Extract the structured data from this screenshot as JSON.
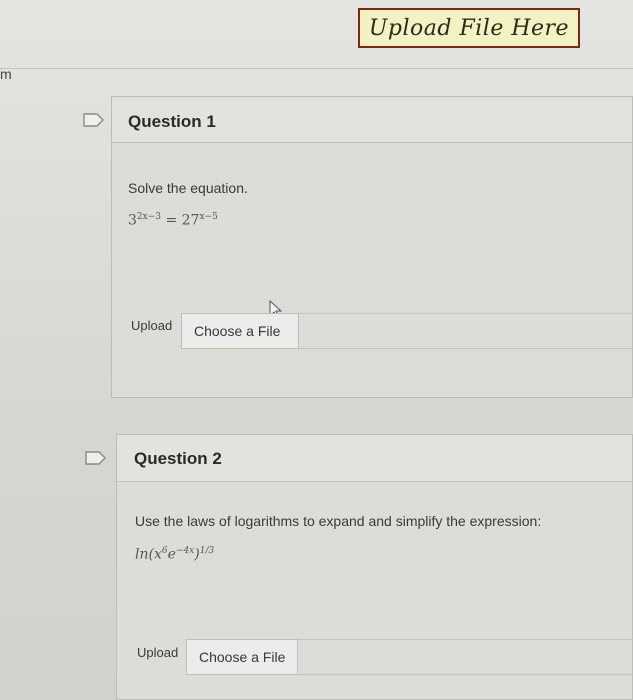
{
  "banner": {
    "label": "Upload File Here"
  },
  "questions": [
    {
      "title": "Question 1",
      "prompt": "Solve the equation.",
      "equation": {
        "base_left": "3",
        "exp_left": "2x−3",
        "equals": "=",
        "base_right": "27",
        "exp_right": "x−5"
      },
      "upload_label": "Upload",
      "file_button": "Choose a File"
    },
    {
      "title": "Question 2",
      "prompt": "Use the laws of logarithms to expand and simplify the expression:",
      "expression": {
        "fn": "ln",
        "inner": "x",
        "inner_exp": "6",
        "e": "e",
        "e_exp": "−4x",
        "outer_exp": "1/3"
      },
      "upload_label": "Upload",
      "file_button": "Choose a File"
    }
  ],
  "colors": {
    "banner_bg": "#f4f1c3",
    "banner_border": "#7a2a10",
    "flag": "#e9e9e6"
  },
  "icons": {
    "flag": "flag-icon",
    "cursor": "arrow-cursor-icon"
  }
}
